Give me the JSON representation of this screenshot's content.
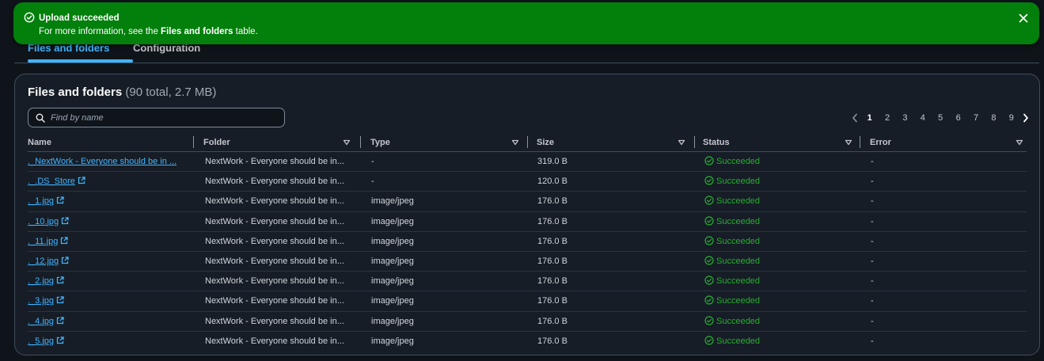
{
  "flash": {
    "title": "Upload succeeded",
    "message_prefix": "For more information, see the ",
    "message_link": "Files and folders",
    "message_suffix": " table.",
    "color": "#037f0c"
  },
  "tabs": [
    {
      "label": "Files and folders",
      "active": true
    },
    {
      "label": "Configuration",
      "active": false
    }
  ],
  "panel": {
    "title": "Files and folders",
    "count": "(90 total, 2.7 MB)"
  },
  "search": {
    "placeholder": "Find by name",
    "value": ""
  },
  "pagination": {
    "pages": [
      "1",
      "2",
      "3",
      "4",
      "5",
      "6",
      "7",
      "8",
      "9"
    ],
    "current": "1"
  },
  "table": {
    "columns": [
      "Name",
      "Folder",
      "Type",
      "Size",
      "Status",
      "Error"
    ],
    "rows": [
      {
        "name": "._NextWork - Everyone should be in a job they love.png",
        "name_display": "._NextWork - Everyone should be in ...",
        "external": false,
        "folder": "NextWork - Everyone should be in...",
        "type": "-",
        "size": "319.0 B",
        "status": "Succeeded",
        "error": "-"
      },
      {
        "name": "._.DS_Store",
        "name_display": "._.DS_Store",
        "external": true,
        "folder": "NextWork - Everyone should be in...",
        "type": "-",
        "size": "120.0 B",
        "status": "Succeeded",
        "error": "-"
      },
      {
        "name": "._1.jpg",
        "name_display": "._1.jpg",
        "external": true,
        "folder": "NextWork - Everyone should be in...",
        "type": "image/jpeg",
        "size": "176.0 B",
        "status": "Succeeded",
        "error": "-"
      },
      {
        "name": "._10.jpg",
        "name_display": "._10.jpg",
        "external": true,
        "folder": "NextWork - Everyone should be in...",
        "type": "image/jpeg",
        "size": "176.0 B",
        "status": "Succeeded",
        "error": "-"
      },
      {
        "name": "._11.jpg",
        "name_display": "._11.jpg",
        "external": true,
        "folder": "NextWork - Everyone should be in...",
        "type": "image/jpeg",
        "size": "176.0 B",
        "status": "Succeeded",
        "error": "-"
      },
      {
        "name": "._12.jpg",
        "name_display": "._12.jpg",
        "external": true,
        "folder": "NextWork - Everyone should be in...",
        "type": "image/jpeg",
        "size": "176.0 B",
        "status": "Succeeded",
        "error": "-"
      },
      {
        "name": "._2.jpg",
        "name_display": "._2.jpg",
        "external": true,
        "folder": "NextWork - Everyone should be in...",
        "type": "image/jpeg",
        "size": "176.0 B",
        "status": "Succeeded",
        "error": "-"
      },
      {
        "name": "._3.jpg",
        "name_display": "._3.jpg",
        "external": true,
        "folder": "NextWork - Everyone should be in...",
        "type": "image/jpeg",
        "size": "176.0 B",
        "status": "Succeeded",
        "error": "-"
      },
      {
        "name": "._4.jpg",
        "name_display": "._4.jpg",
        "external": true,
        "folder": "NextWork - Everyone should be in...",
        "type": "image/jpeg",
        "size": "176.0 B",
        "status": "Succeeded",
        "error": "-"
      },
      {
        "name": "._5.jpg",
        "name_display": "._5.jpg",
        "external": true,
        "folder": "NextWork - Everyone should be in...",
        "type": "image/jpeg",
        "size": "176.0 B",
        "status": "Succeeded",
        "error": "-"
      }
    ]
  },
  "icons": {
    "success": "check-circle-icon",
    "close": "close-icon",
    "search": "search-icon",
    "external": "external-link-icon",
    "sort": "caret-down-icon",
    "prev": "chevron-left-icon",
    "next": "chevron-right-icon"
  },
  "colors": {
    "link": "#42b4ff",
    "success_text": "#29ad32",
    "panel_bg": "#161d26",
    "page_bg": "#0f141a"
  }
}
